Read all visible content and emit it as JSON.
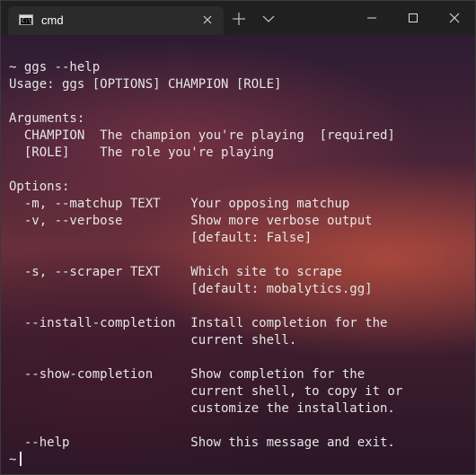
{
  "tab": {
    "title": "cmd",
    "icon": "console-icon"
  },
  "window_controls": [
    "minimize",
    "maximize",
    "close"
  ],
  "terminal": {
    "lines": [
      "~ ggs --help",
      "Usage: ggs [OPTIONS] CHAMPION [ROLE]",
      "",
      "Arguments:",
      "  CHAMPION  The champion you're playing  [required]",
      "  [ROLE]    The role you're playing",
      "",
      "Options:",
      "  -m, --matchup TEXT    Your opposing matchup",
      "  -v, --verbose         Show more verbose output",
      "                        [default: False]",
      "",
      "  -s, --scraper TEXT    Which site to scrape",
      "                        [default: mobalytics.gg]",
      "",
      "  --install-completion  Install completion for the",
      "                        current shell.",
      "",
      "  --show-completion     Show completion for the",
      "                        current shell, to copy it or",
      "                        customize the installation.",
      "",
      "  --help                Show this message and exit."
    ],
    "prompt": "~"
  },
  "colors": {
    "titlebar": "#202020",
    "tab": "#2b2b2b",
    "text": "#e6e6e6"
  }
}
